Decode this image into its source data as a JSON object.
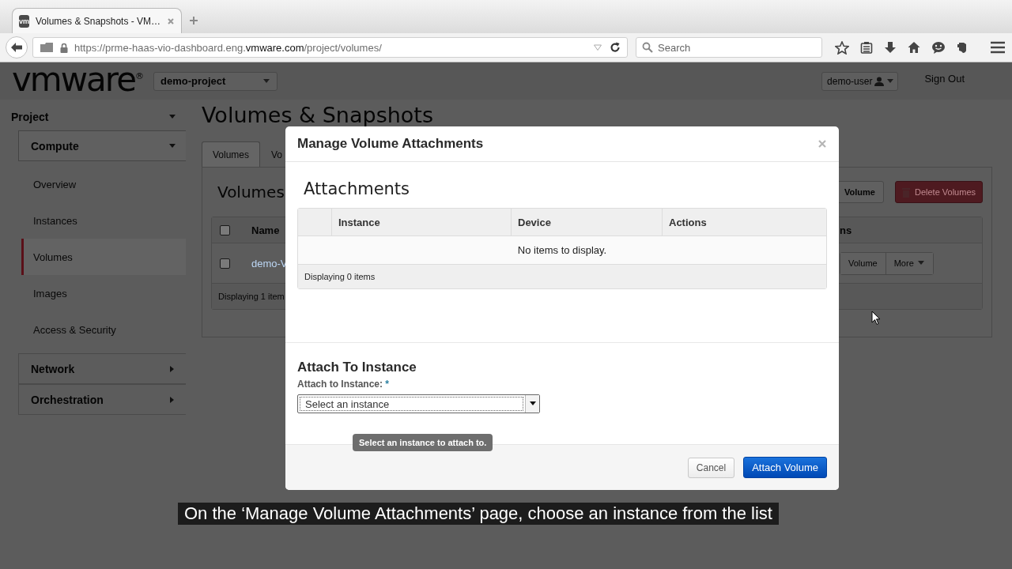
{
  "browser": {
    "tab": {
      "favicon": "vm",
      "title": "Volumes & Snapshots - VM…",
      "selected": true
    },
    "url": {
      "host_start": "https://prme-haas-vio-dashboard.eng.",
      "domain": "vmware.com",
      "path": "/project/volumes/"
    },
    "search": {
      "placeholder": "Search"
    }
  },
  "header": {
    "logo": "vmware$^{®}$",
    "project": "demo-project",
    "user": "demo-user",
    "sign_out": "Sign Out"
  },
  "sidebar": {
    "title": "Project",
    "expanded": true,
    "groups": [
      {
        "label": "Compute",
        "expanded": true,
        "children": [
          {
            "label": "Overview",
            "selected": false
          },
          {
            "label": "Instances",
            "selected": false
          },
          {
            "label": "Volumes",
            "selected": true
          },
          {
            "label": "Images",
            "selected": false
          },
          {
            "label": "Access & Security",
            "selected": false
          }
        ]
      },
      {
        "label": "Network",
        "expanded": false
      },
      {
        "label": "Orchestration",
        "expanded": false
      }
    ]
  },
  "page": {
    "title": "Volumes & Snapshots",
    "tabs": [
      {
        "label": "Volumes",
        "selected": true
      },
      {
        "label": "Vo",
        "selected": false
      }
    ],
    "heading": "Volumes",
    "create_button": "Volume",
    "delete_button": "Delete Volumes",
    "table": {
      "select_all_checked": false,
      "columns": [
        "Name",
        "ns"
      ],
      "rows": [
        {
          "checked": false,
          "name": "demo-V",
          "actions": [
            "Volume",
            "More"
          ]
        }
      ],
      "footer": "Displaying 1 item"
    }
  },
  "modal": {
    "title": "Manage Volume Attachments",
    "heading": "Attachments",
    "table": {
      "columns": [
        "Instance",
        "Device",
        "Actions"
      ],
      "empty": "No items to display.",
      "footer": "Displaying 0 items"
    },
    "form_title": "Attach To Instance",
    "field": {
      "label": "Attach to Instance:",
      "required_mark": "*",
      "value": "Select an instance"
    },
    "tooltip": "Select an instance to attach to.",
    "buttons": [
      {
        "label": "Cancel",
        "kind": "default"
      },
      {
        "label": "Attach Volume",
        "kind": "primary"
      }
    ]
  },
  "caption": "On the ‘Manage Volume Attachments’ page, choose an instance from the list"
}
